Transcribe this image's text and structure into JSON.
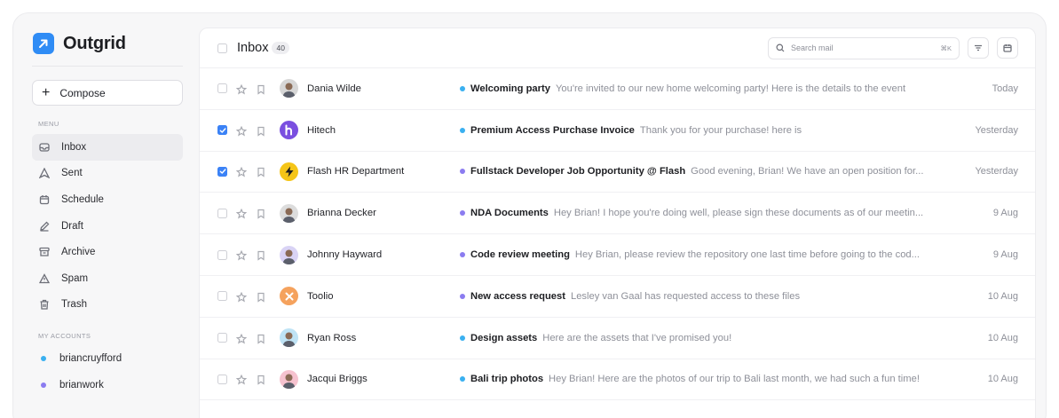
{
  "app": {
    "name": "Outgrid"
  },
  "sidebar": {
    "compose_label": "Compose",
    "menu_label": "MENU",
    "items": [
      {
        "label": "Inbox",
        "icon": "inbox-icon",
        "active": true
      },
      {
        "label": "Sent",
        "icon": "send-icon"
      },
      {
        "label": "Schedule",
        "icon": "calendar-icon"
      },
      {
        "label": "Draft",
        "icon": "pencil-icon"
      },
      {
        "label": "Archive",
        "icon": "archive-icon"
      },
      {
        "label": "Spam",
        "icon": "warning-icon"
      },
      {
        "label": "Trash",
        "icon": "trash-icon"
      }
    ],
    "accounts_label": "MY ACCOUNTS",
    "accounts": [
      {
        "name": "briancruyfford",
        "color": "#3ab0f0"
      },
      {
        "name": "brianwork",
        "color": "#8b7cf0"
      }
    ]
  },
  "header": {
    "title": "Inbox",
    "count": "40",
    "search_placeholder": "Search mail",
    "search_shortcut": "⌘K"
  },
  "colors": {
    "accent": "#3b82f6",
    "blue_label": "#3ab0f0",
    "purple_label": "#8b7cf0"
  },
  "emails": [
    {
      "sender": "Dania Wilde",
      "subject": "Welcoming party",
      "preview": "You're invited to our new home welcoming party! Here is the details to the event",
      "date": "Today",
      "checked": false,
      "label_color": "#3ab0f0",
      "avatar_bg": "#d7d7d7",
      "avatar_type": "person"
    },
    {
      "sender": "Hitech",
      "subject": "Premium Access Purchase Invoice",
      "preview": "Thank you for your purchase! here is",
      "date": "Yesterday",
      "checked": true,
      "label_color": "#3ab0f0",
      "avatar_bg": "#7a4fe0",
      "avatar_type": "h-logo"
    },
    {
      "sender": "Flash HR Department",
      "subject": "Fullstack Developer Job Opportunity @ Flash",
      "preview": "Good evening, Brian! We have an open position for...",
      "date": "Yesterday",
      "checked": true,
      "label_color": "#8b7cf0",
      "avatar_bg": "#f5c518",
      "avatar_type": "bolt"
    },
    {
      "sender": "Brianna Decker",
      "subject": "NDA Documents",
      "preview": "Hey Brian! I hope you're doing well, please sign these documents as of our meetin...",
      "date": "9 Aug",
      "checked": false,
      "label_color": "#8b7cf0",
      "avatar_bg": "#dcdcdc",
      "avatar_type": "person"
    },
    {
      "sender": "Johnny Hayward",
      "subject": "Code review meeting",
      "preview": "Hey Brian, please review the repository one last time before going to the cod...",
      "date": "9 Aug",
      "checked": false,
      "label_color": "#8b7cf0",
      "avatar_bg": "#d9d3f5",
      "avatar_type": "person"
    },
    {
      "sender": "Toolio",
      "subject": "New access request",
      "preview": "Lesley van Gaal has requested access to these files",
      "date": "10 Aug",
      "checked": false,
      "label_color": "#8b7cf0",
      "avatar_bg": "#f5a25d",
      "avatar_type": "cross-logo"
    },
    {
      "sender": "Ryan Ross",
      "subject": "Design assets",
      "preview": "Here are the assets that I've promised you!",
      "date": "10 Aug",
      "checked": false,
      "label_color": "#3ab0f0",
      "avatar_bg": "#bfe3f5",
      "avatar_type": "person"
    },
    {
      "sender": "Jacqui Briggs",
      "subject": "Bali trip photos",
      "preview": "Hey Brian! Here are the photos of our trip to Bali last month, we had such a fun time!",
      "date": "10 Aug",
      "checked": false,
      "label_color": "#3ab0f0",
      "avatar_bg": "#f6c2cf",
      "avatar_type": "person"
    }
  ]
}
